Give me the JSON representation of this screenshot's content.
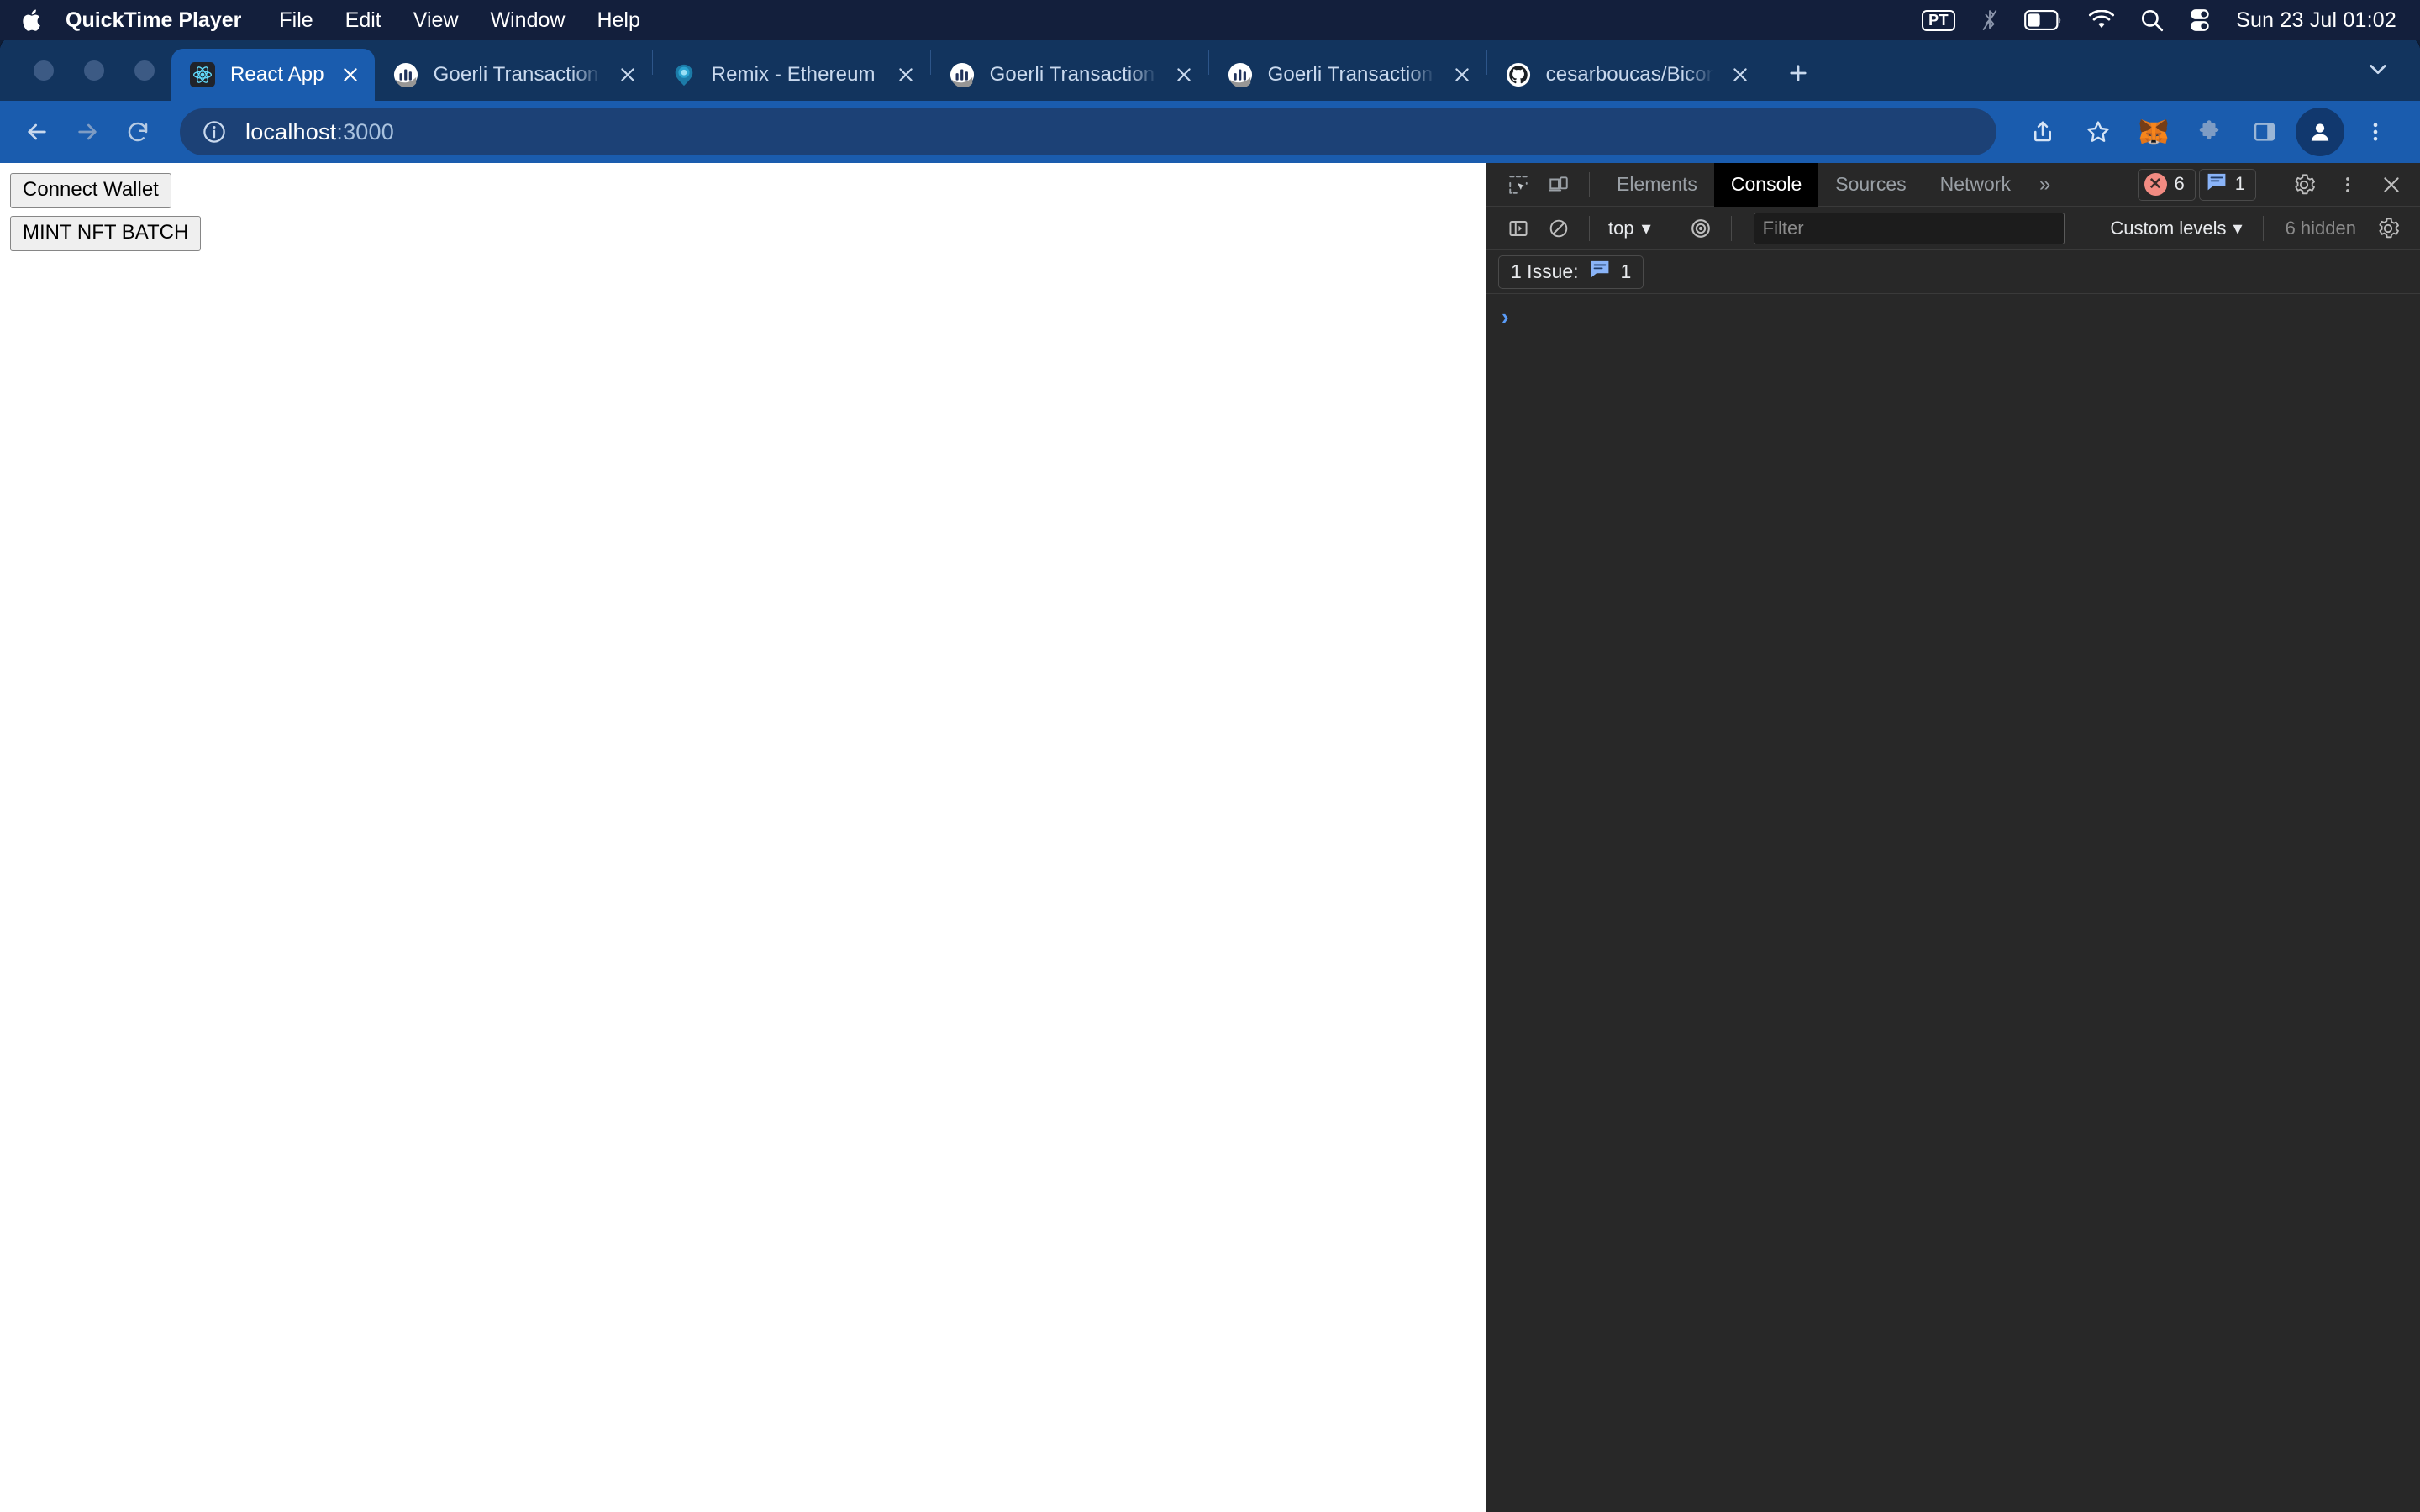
{
  "menubar": {
    "apple_icon": "apple-logo-icon",
    "app_name": "QuickTime Player",
    "items": [
      "File",
      "Edit",
      "View",
      "Window",
      "Help"
    ],
    "status": {
      "input_source": "PT",
      "bluetooth_icon": "bluetooth-off-icon",
      "battery_icon": "battery-icon",
      "wifi_icon": "wifi-icon",
      "search_icon": "spotlight-search-icon",
      "control_center_icon": "control-center-icon",
      "clock": "Sun 23 Jul  01:02"
    }
  },
  "browser": {
    "tabs": [
      {
        "title": "React App",
        "favicon": "react-logo-icon",
        "active": true,
        "truncated": false
      },
      {
        "title": "Goerli Transaction Hash (",
        "favicon": "etherscan-logo-icon",
        "active": false,
        "truncated": true
      },
      {
        "title": "Remix - Ethereum IDE",
        "favicon": "remix-logo-icon",
        "active": false,
        "truncated": false
      },
      {
        "title": "Goerli Transaction Hash (",
        "favicon": "etherscan-logo-icon",
        "active": false,
        "truncated": true
      },
      {
        "title": "Goerli Transaction Hash (",
        "favicon": "etherscan-logo-icon",
        "active": false,
        "truncated": true
      },
      {
        "title": "cesarboucas/BiconomyB",
        "favicon": "github-logo-icon",
        "active": false,
        "truncated": true
      }
    ],
    "new_tab_label": "+",
    "tab_search_icon": "chevron-down-icon",
    "toolbar": {
      "back_icon": "back-arrow-icon",
      "forward_icon": "forward-arrow-icon",
      "reload_icon": "reload-icon",
      "site_info_icon": "info-circle-icon",
      "url_host": "localhost",
      "url_port": ":3000",
      "url_full": "localhost:3000",
      "share_icon": "share-icon",
      "bookmark_icon": "star-icon",
      "metamask_icon": "metamask-fox-icon",
      "extensions_icon": "puzzle-piece-icon",
      "sidepanel_icon": "side-panel-icon",
      "profile_icon": "profile-avatar-icon",
      "menu_icon": "three-dot-menu-icon"
    }
  },
  "page": {
    "connect_wallet_label": "Connect Wallet",
    "mint_nft_label": "MINT NFT BATCH"
  },
  "devtools": {
    "inspect_icon": "inspect-element-icon",
    "device_toolbar_icon": "device-toolbar-icon",
    "tabs": [
      {
        "label": "Elements",
        "active": false
      },
      {
        "label": "Console",
        "active": true
      },
      {
        "label": "Sources",
        "active": false
      },
      {
        "label": "Network",
        "active": false
      }
    ],
    "more_tabs_icon": "double-chevron-right-icon",
    "error_count": "6",
    "message_count": "1",
    "settings_icon": "gear-icon",
    "kebab_icon": "three-dot-menu-icon",
    "close_icon": "close-icon",
    "console_toolbar": {
      "sidebar_icon": "console-sidebar-icon",
      "clear_icon": "clear-console-icon",
      "context": "top",
      "context_caret": "▾",
      "live_expression_icon": "eye-icon",
      "filter_placeholder": "Filter",
      "filter_value": "",
      "levels_label": "Custom levels",
      "levels_caret": "▾",
      "hidden_label": "6 hidden",
      "console_settings_icon": "gear-icon"
    },
    "issues_bar": {
      "label": "1 Issue:",
      "icon": "issue-message-icon",
      "count": "1"
    },
    "prompt_caret": "›"
  },
  "colors": {
    "menubar_bg": "#131f3c",
    "tabstrip_bg": "#12345e",
    "toolbar_bg": "#1a5cae",
    "omnibox_bg": "#1c4176",
    "active_tab_bg": "#1a5cae",
    "devtools_bg": "#282828",
    "console_active_tab_bg": "#000000",
    "error_badge": "#f28b82",
    "message_badge": "#8ab4f8",
    "prompt_blue": "#5a9cf8",
    "metamask_orange": "#e2761b",
    "page_bg": "#ffffff"
  }
}
